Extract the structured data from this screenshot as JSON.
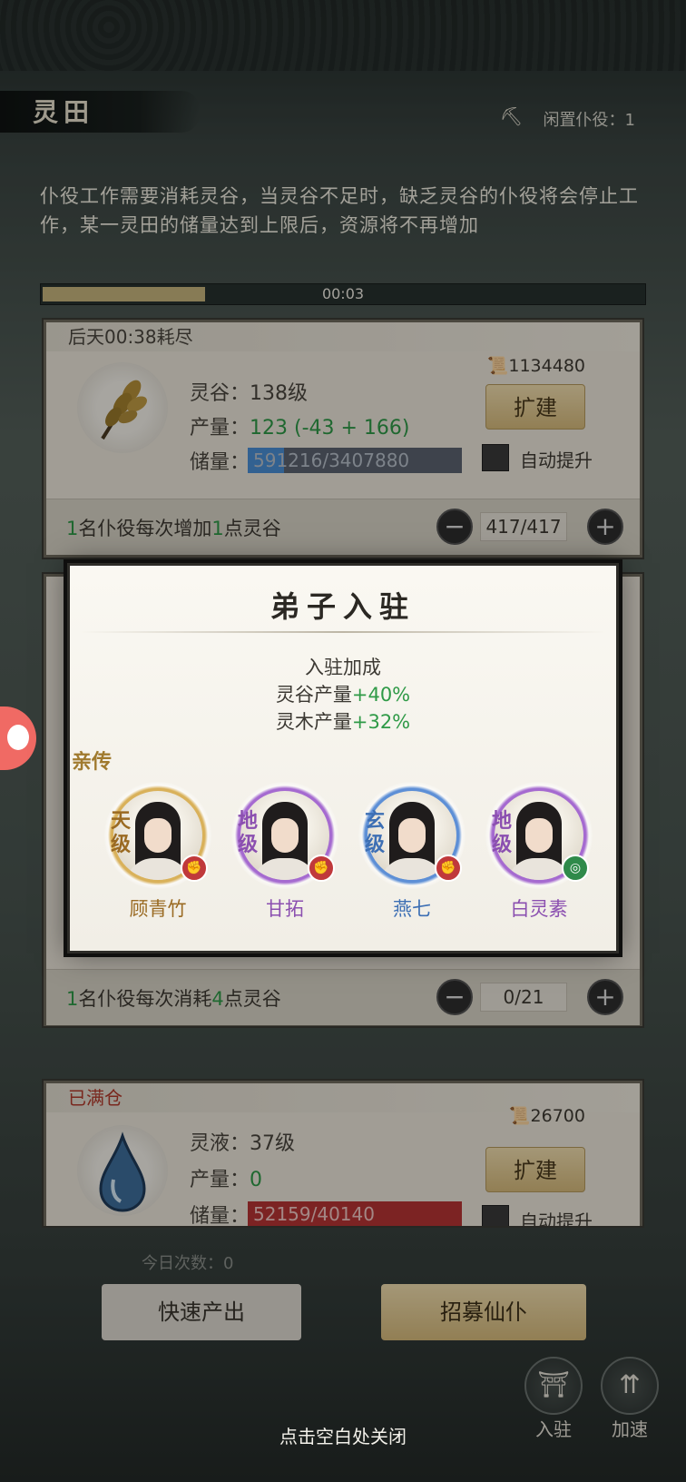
{
  "header": {
    "title": "灵田",
    "idle_label": "闲置仆役：1",
    "idle_icon": "servant-icon"
  },
  "description": "仆役工作需要消耗灵谷，当灵谷不足时，缺乏灵谷的仆役将会停止工作，某一灵田的储量达到上限后，资源将不再增加",
  "timer": {
    "text": "00:03",
    "progress": 0.27
  },
  "field1": {
    "status": "后天00:38耗尽",
    "resource_line": "灵谷：138级",
    "output_label": "产量：",
    "output_value": "123 (-43 + 166)",
    "storage_label": "储量：",
    "storage_value": "591216/3407880",
    "storage_fraction": 0.17,
    "cost": "1134480",
    "expand_label": "扩建",
    "auto_label": "自动提升",
    "foot": {
      "n1": "1",
      "t1": "名仆役每次增加",
      "n2": "1",
      "t2": "点灵谷"
    },
    "counter": "417/417"
  },
  "field2": {
    "foot": {
      "n1": "1",
      "t1": "名仆役每次消耗",
      "n2": "4",
      "t2": "点灵谷"
    },
    "counter": "0/21"
  },
  "field3": {
    "status": "已满仓",
    "resource_line": "灵液：37级",
    "output_label": "产量：",
    "output_value": "0",
    "storage_label": "储量：",
    "storage_value": "52159/40140",
    "cost": "26700",
    "expand_label": "扩建",
    "auto_label": "自动提升"
  },
  "modal": {
    "title": "弟子入驻",
    "bonus_title": "入驻加成",
    "bonus1_label": "灵谷产量",
    "bonus1_value": "+40%",
    "bonus2_label": "灵木产量",
    "bonus2_value": "+32%",
    "special_tag": "亲传",
    "disciples": [
      {
        "name": "顾青竹",
        "grade": "天级",
        "name_color": "#9a6a22",
        "ring_color": "#d9b15a",
        "badge_color": "#c0393b",
        "badge_icon": "fist-icon"
      },
      {
        "name": "甘拓",
        "grade": "地级",
        "name_color": "#8b4fb0",
        "ring_color": "#a56ad0",
        "badge_color": "#c0393b",
        "badge_icon": "fist-icon"
      },
      {
        "name": "燕七",
        "grade": "玄级",
        "name_color": "#3d6fb4",
        "ring_color": "#5d8fd6",
        "badge_color": "#c0393b",
        "badge_icon": "fist-icon"
      },
      {
        "name": "白灵素",
        "grade": "地级",
        "name_color": "#8b4fb0",
        "ring_color": "#a56ad0",
        "badge_color": "#2f8a4a",
        "badge_icon": "swirl-icon"
      }
    ]
  },
  "bottom": {
    "daily": "今日次数：0",
    "quick_label": "快速产出",
    "recruit_label": "招募仙仆",
    "station_label": "入驻",
    "speed_label": "加速",
    "close_hint": "点击空白处关闭"
  }
}
